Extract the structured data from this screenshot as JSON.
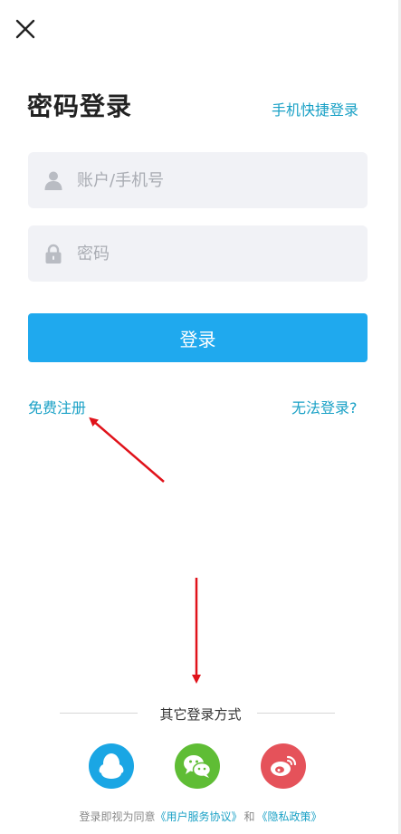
{
  "header": {
    "close_icon": "close-icon",
    "title": "密码登录",
    "alt_login": "手机快捷登录"
  },
  "form": {
    "account": {
      "placeholder": "账户/手机号",
      "value": "",
      "icon": "user-icon"
    },
    "password": {
      "placeholder": "密码",
      "value": "",
      "icon": "lock-icon"
    },
    "submit_label": "登录"
  },
  "links": {
    "register": "免费注册",
    "cant_login": "无法登录?"
  },
  "other_methods": {
    "label": "其它登录方式",
    "items": [
      {
        "name": "qq",
        "icon": "qq-icon",
        "color": "#1aa6e4"
      },
      {
        "name": "wechat",
        "icon": "wechat-icon",
        "color": "#5fbd35"
      },
      {
        "name": "weibo",
        "icon": "weibo-icon",
        "color": "#e5525a"
      }
    ]
  },
  "agreement": {
    "prefix": "登录即视为同意",
    "service": "《用户服务协议》",
    "and": "和",
    "privacy": "《隐私政策》"
  },
  "colors": {
    "accent": "#1aa1c6",
    "button": "#1fa9ee",
    "annotation_arrow": "#e0121a"
  }
}
